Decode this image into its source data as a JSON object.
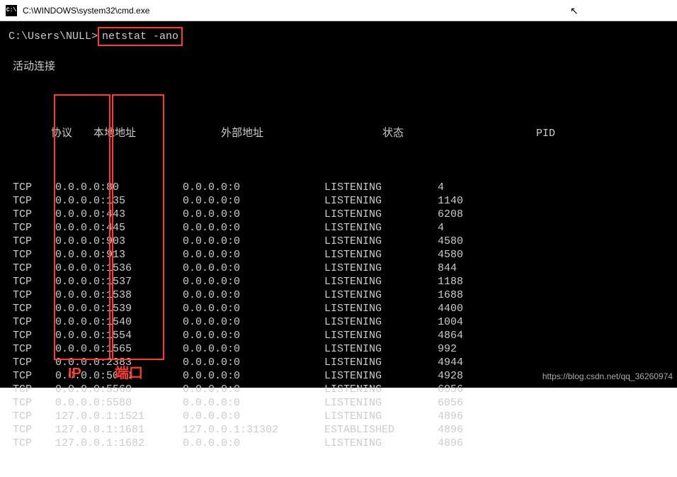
{
  "titlebar": {
    "icon_text": "C:\\",
    "title": "C:\\WINDOWS\\system32\\cmd.exe"
  },
  "prompt": {
    "path": "C:\\Users\\NULL>",
    "command": "netstat -ano"
  },
  "section_title": "活动连接",
  "headers": {
    "proto": "协议",
    "local": "本地地址",
    "foreign": "外部地址",
    "state": "状态",
    "pid": "PID"
  },
  "rows": [
    {
      "proto": "TCP",
      "local": "0.0.0.0:80",
      "foreign": "0.0.0.0:0",
      "state": "LISTENING",
      "pid": "4"
    },
    {
      "proto": "TCP",
      "local": "0.0.0.0:135",
      "foreign": "0.0.0.0:0",
      "state": "LISTENING",
      "pid": "1140"
    },
    {
      "proto": "TCP",
      "local": "0.0.0.0:443",
      "foreign": "0.0.0.0:0",
      "state": "LISTENING",
      "pid": "6208"
    },
    {
      "proto": "TCP",
      "local": "0.0.0.0:445",
      "foreign": "0.0.0.0:0",
      "state": "LISTENING",
      "pid": "4"
    },
    {
      "proto": "TCP",
      "local": "0.0.0.0:903",
      "foreign": "0.0.0.0:0",
      "state": "LISTENING",
      "pid": "4580"
    },
    {
      "proto": "TCP",
      "local": "0.0.0.0:913",
      "foreign": "0.0.0.0:0",
      "state": "LISTENING",
      "pid": "4580"
    },
    {
      "proto": "TCP",
      "local": "0.0.0.0:1536",
      "foreign": "0.0.0.0:0",
      "state": "LISTENING",
      "pid": "844"
    },
    {
      "proto": "TCP",
      "local": "0.0.0.0:1537",
      "foreign": "0.0.0.0:0",
      "state": "LISTENING",
      "pid": "1188"
    },
    {
      "proto": "TCP",
      "local": "0.0.0.0:1538",
      "foreign": "0.0.0.0:0",
      "state": "LISTENING",
      "pid": "1688"
    },
    {
      "proto": "TCP",
      "local": "0.0.0.0:1539",
      "foreign": "0.0.0.0:0",
      "state": "LISTENING",
      "pid": "4400"
    },
    {
      "proto": "TCP",
      "local": "0.0.0.0:1540",
      "foreign": "0.0.0.0:0",
      "state": "LISTENING",
      "pid": "1004"
    },
    {
      "proto": "TCP",
      "local": "0.0.0.0:1554",
      "foreign": "0.0.0.0:0",
      "state": "LISTENING",
      "pid": "4864"
    },
    {
      "proto": "TCP",
      "local": "0.0.0.0:1565",
      "foreign": "0.0.0.0:0",
      "state": "LISTENING",
      "pid": "992"
    },
    {
      "proto": "TCP",
      "local": "0.0.0.0:2383",
      "foreign": "0.0.0.0:0",
      "state": "LISTENING",
      "pid": "4944"
    },
    {
      "proto": "TCP",
      "local": "0.0.0.0:5040",
      "foreign": "0.0.0.0:0",
      "state": "LISTENING",
      "pid": "4928"
    },
    {
      "proto": "TCP",
      "local": "0.0.0.0:5560",
      "foreign": "0.0.0.0:0",
      "state": "LISTENING",
      "pid": "6056"
    },
    {
      "proto": "TCP",
      "local": "0.0.0.0:5580",
      "foreign": "0.0.0.0:0",
      "state": "LISTENING",
      "pid": "6056"
    },
    {
      "proto": "TCP",
      "local": "127.0.0.1:1521",
      "foreign": "0.0.0.0:0",
      "state": "LISTENING",
      "pid": "4896"
    },
    {
      "proto": "TCP",
      "local": "127.0.0.1:1681",
      "foreign": "127.0.0.1:31302",
      "state": "ESTABLISHED",
      "pid": "4896"
    },
    {
      "proto": "TCP",
      "local": "127.0.0.1:1682",
      "foreign": "0.0.0.0:0",
      "state": "LISTENING",
      "pid": "4896"
    }
  ],
  "annotations": {
    "ip_label": "IP",
    "port_label": "端口"
  },
  "watermark": "https://blog.csdn.net/qq_36260974"
}
